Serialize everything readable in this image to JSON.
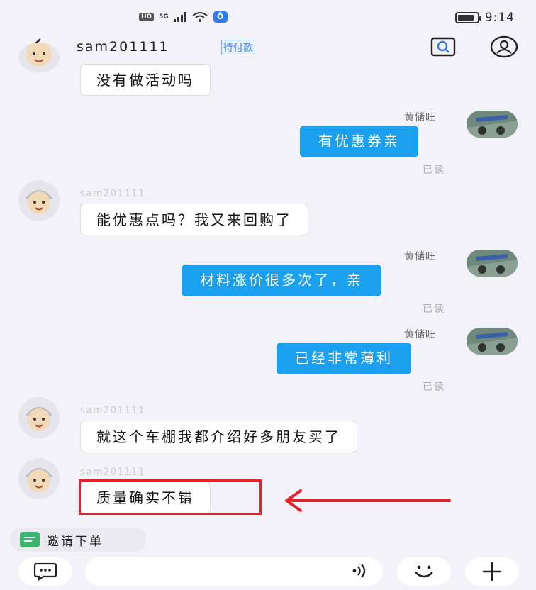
{
  "status_bar": {
    "hd": "HD",
    "network": "5G",
    "time": "9:14",
    "battery_level": 0.85
  },
  "header": {
    "title": "sam201111",
    "tag": "待付款"
  },
  "messages": [
    {
      "side": "left",
      "text": "没有做活动吗"
    },
    {
      "side": "right",
      "sender": "黄储旺",
      "text": "有优惠券亲",
      "status": "已读"
    },
    {
      "side": "left",
      "sender": "sam201111",
      "text": "能优惠点吗？我又来回购了"
    },
    {
      "side": "right",
      "sender": "黄储旺",
      "text": "材料涨价很多次了，亲",
      "status": "已读"
    },
    {
      "side": "right",
      "sender": "黄储旺",
      "text": "已经非常薄利",
      "status": "已读"
    },
    {
      "side": "left",
      "sender": "sam201111",
      "text": "就这个车棚我都介绍好多朋友买了"
    },
    {
      "side": "left",
      "sender": "sam201111",
      "text": "质量确实不错"
    }
  ],
  "invite": {
    "label": "邀请下单",
    "icon": "invite-order-icon"
  },
  "input": {
    "placeholder": "",
    "icons": [
      "chat-icon",
      "voice-icon",
      "emoji-icon",
      "plus-icon"
    ]
  },
  "colors": {
    "background": "#f3f2f8",
    "bubble_self": "#1aa0ef",
    "accent": "#2f7bf0",
    "highlight": "#e0242a"
  }
}
